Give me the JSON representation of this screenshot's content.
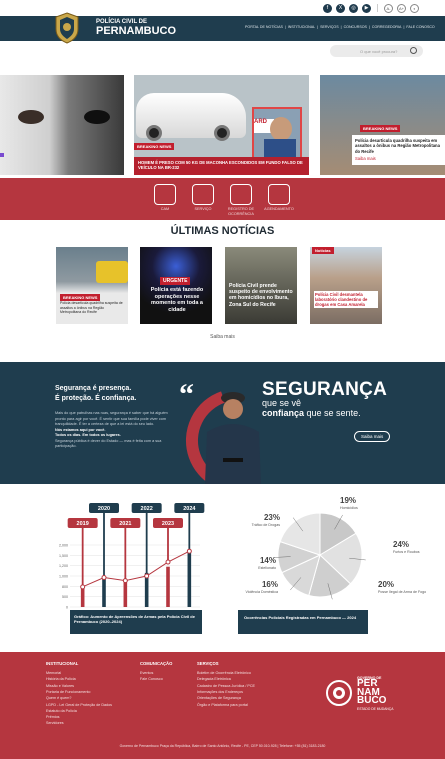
{
  "header": {
    "brand_line1": "POLÍCIA CIVIL DE",
    "brand_line2": "PERNAMBUCO",
    "nav": [
      "PORTAL DE NOTÍCIAS",
      "INSTITUCIONAL",
      "SERVIÇOS",
      "CONCURSOS",
      "CORREGEDORIA",
      "FALE CONOSCO"
    ],
    "search_placeholder": "O que você procura?",
    "colors": {
      "primary": "#1f3d4e",
      "accent": "#b5363f"
    }
  },
  "topbar": {
    "social": [
      "facebook-icon",
      "x-icon",
      "instagram-icon",
      "youtube-icon"
    ],
    "accessibility": [
      "A-",
      "A+",
      "◐"
    ]
  },
  "hero": {
    "card2_badge": "BREAKING NEWS",
    "card2_caption": "HOMEM É PRESO COM 50 KG DE MACONHA ESCONDIDOS EM FUNDO FALSO DE VEÍCULO NA BR-232",
    "card2_banner": "ARD",
    "card3_badge": "BREAKING NEWS",
    "card3_caption": "Polícia desarticula quadrilha suspeita em assaltos a ônibus na Região Metropolitana do Recife",
    "card3_more": "Saiba mais"
  },
  "services": [
    {
      "label": "CAM",
      "icon": "building-icon"
    },
    {
      "label": "SERVIÇO",
      "icon": "document-icon"
    },
    {
      "label": "REGISTRO DE OCORRÊNCIA",
      "icon": "report-icon"
    },
    {
      "label": "AGENDAMENTO",
      "icon": "calendar-icon"
    }
  ],
  "news": {
    "title": "ÚLTIMAS NOTÍCIAS",
    "items": [
      {
        "tag": "BREAKING NEWS",
        "headline": "Polícia desarticula quadrilha suspeita de assaltos a ônibus na Região Metropolitana do Recife"
      },
      {
        "tag": "URGENTE",
        "headline": "Polícia está fazendo operações nesse momento em toda a cidade"
      },
      {
        "tag": "",
        "headline": "Polícia Civil prende suspeito de envolvimento em homicídios no Ibura, Zona Sul do Recife"
      },
      {
        "tag": "Notícias",
        "headline": "Polícia Civil desmantela laboratório clandestino de drogas em Casa Amarela"
      }
    ],
    "more": "Saiba mais"
  },
  "security": {
    "title_line1": "Segurança é presença.",
    "title_line2": "É proteção. É confiança.",
    "body": "Mais do que patrulhas nas ruas, segurança é saber que há alguém pronto para agir por você. É sentir que sua família pode viver com tranquilidade. É ter a certeza de que a lei está do seu lado.",
    "body_bold1": "Nós estamos aqui por você.",
    "body_bold2": "Todos os dias. Em todos os lugares.",
    "body_end": "Segurança pública é dever do Estado — mas é feita com a sua participação.",
    "big": "SEGURANÇA",
    "tag_pre": "que se vê",
    "tag_bold": "confiança",
    "tag_post": "que se sente.",
    "button": "Saiba mais"
  },
  "chart_data": [
    {
      "type": "bar",
      "title": "Gráfico: Aumento de Apreensões de Armas pela Polícia Civil de Pernambuco (2020–2024)",
      "categories": [
        "2019",
        "2020",
        "2021",
        "2022",
        "2023",
        "2024"
      ],
      "values": [
        650,
        950,
        800,
        1100,
        1300,
        1800
      ],
      "line_values": [
        650,
        950,
        850,
        1000,
        1450,
        1800
      ],
      "yticks": [
        "2,000",
        "1,500",
        "1,200",
        "1,000",
        "800",
        "500",
        "0"
      ],
      "ylim": [
        0,
        2000
      ]
    },
    {
      "type": "pie",
      "title": "Ocorrências Policiais Registradas em Pernambuco — 2024",
      "slices": [
        {
          "label": "Homicídios",
          "value": 19
        },
        {
          "label": "Furtos e Roubos",
          "value": 24
        },
        {
          "label": "Posse Ilegal de Arma de Fogo",
          "value": 20
        },
        {
          "label": "Violência Doméstica",
          "value": 16
        },
        {
          "label": "Estelionato",
          "value": 14
        },
        {
          "label": "Tráfico de Drogas",
          "value": 23
        }
      ],
      "display": [
        "19%",
        "24%",
        "20%",
        "16%",
        "14%",
        "23%"
      ]
    }
  ],
  "footer": {
    "col1": {
      "title": "INSTITUCIONAL",
      "items": [
        "Memorial",
        "História da Polícia",
        "Missão e Valores",
        "Portaria de Funcionamento",
        "Quem é quem?",
        "LGPD - Lei Geral de Proteção de Dados",
        "Estatuto da Polícia",
        "Prêmios",
        "Servidores"
      ]
    },
    "col2": {
      "title": "COMUNICAÇÃO",
      "items": [
        "Eventos",
        "Fale Conosco"
      ]
    },
    "col3": {
      "title": "SERVIÇOS",
      "items": [
        "Boletim de Ocorrência Eletrônico",
        "Delegacia Eletrônica",
        "Cadastro de Pessoa Jurídica / PCE",
        "Informações dos Endereços",
        "Orientações de Segurança",
        "Órgão e Plataforma para portal"
      ]
    },
    "gov_line1": "GOVERNO DE",
    "gov_line2": "PER",
    "gov_line3": "NAM",
    "gov_line4": "BUCO",
    "gov_line5": "ESTADO DE MUDANÇA",
    "address": "Governo de Pernambuco Praça da República, Bairro de Santo Antônio, Recife - PE, CEP 50.010-928 | Telefone: +55 (81) 3183-2180"
  }
}
